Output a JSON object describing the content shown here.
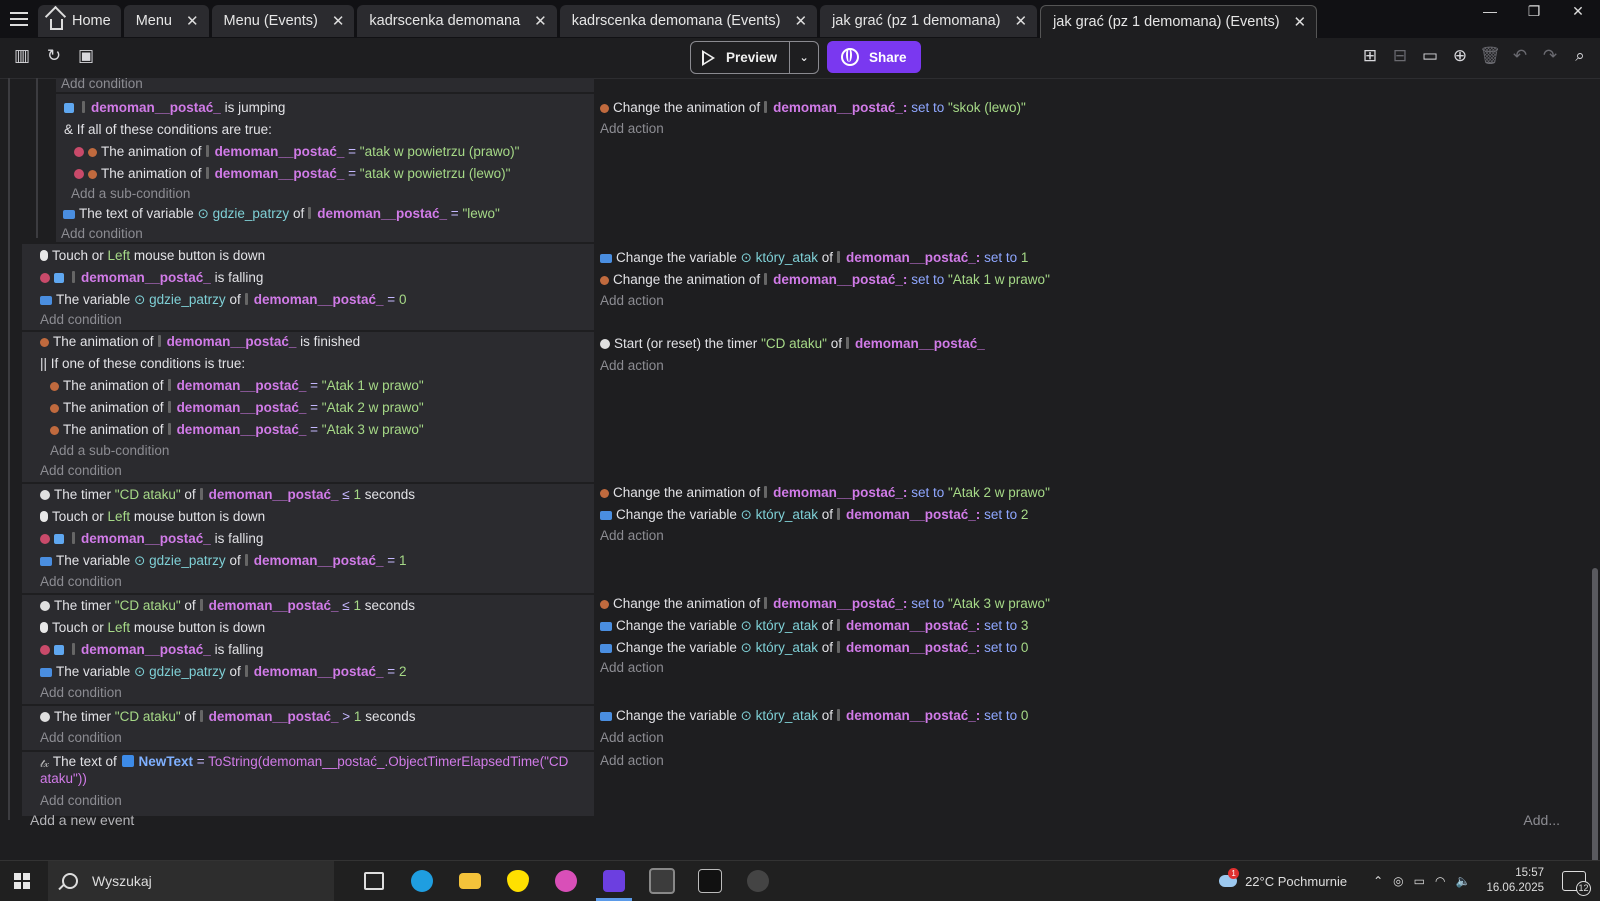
{
  "tabs": [
    {
      "label": "Home",
      "home": true,
      "closable": false
    },
    {
      "label": "Menu",
      "closable": true
    },
    {
      "label": "Menu (Events)",
      "closable": true
    },
    {
      "label": "kadrscenka demomana",
      "closable": true
    },
    {
      "label": "kadrscenka demomana (Events)",
      "closable": true
    },
    {
      "label": "jak grać (pz 1 demomana)",
      "closable": true
    },
    {
      "label": "jak grać (pz 1 demomana) (Events)",
      "closable": true,
      "active": true
    }
  ],
  "window": {
    "minimize": "—",
    "maximize": "❐",
    "close": "✕"
  },
  "toolbar": {
    "preview_label": "Preview",
    "share_label": "Share"
  },
  "common": {
    "add_condition": "Add condition",
    "add_action": "Add action",
    "add_subcondition": "Add a sub-condition",
    "obj": "demoman__postać_",
    "anim_of": "The animation of",
    "change_anim": "Change the animation of",
    "change_var": "Change the variable",
    "set_to": "set to",
    "of": "of",
    "seconds": "seconds",
    "touch_or": "Touch or",
    "left": "Left",
    "mouse_down": "mouse button is down",
    "is_falling": "is falling",
    "the_variable": "The variable",
    "the_timer": "The timer",
    "var_gdzie": "gdzie_patrzy",
    "var_ktory": "który_atak",
    "timer_name": "\"CD ataku\""
  },
  "event1": {
    "is_jumping": "is jumping",
    "if_all": "If all of these conditions are true:",
    "anim_prawo": "\"atak w powietrzu (prawo)\"",
    "anim_lewo": "\"atak w powietrzu (lewo)\"",
    "text_of_var": "The text of variable",
    "lewo": "\"lewo\"",
    "action_anim": "\"skok (lewo)\""
  },
  "event2": {
    "var_value": "0",
    "action_var_value": "1",
    "action_anim": "\"Atak 1 w prawo\""
  },
  "event3": {
    "is_finished": "is finished",
    "if_one": "If one of these conditions is true:",
    "a1": "\"Atak 1 w prawo\"",
    "a2": "\"Atak 2 w prawo\"",
    "a3": "\"Atak 3 w prawo\"",
    "action_start": "Start (or reset) the timer"
  },
  "event4": {
    "op": "≤",
    "timer_val": "1",
    "var_value": "1",
    "action_anim": "\"Atak 2 w prawo\"",
    "action_var_value": "2"
  },
  "event5": {
    "op": "≤",
    "timer_val": "1",
    "var_value": "2",
    "action_anim": "\"Atak 3 w prawo\"",
    "action_var_value_1": "3",
    "action_var_value_2": "0"
  },
  "event6": {
    "op": ">",
    "timer_val": "1",
    "action_var_value": "0"
  },
  "event7": {
    "text_of": "The text of",
    "newtext": "NewText",
    "eq": "=",
    "expr_1": "ToString(demoman__postać_.ObjectTimerElapsedTime(\"CD",
    "expr_2": "ataku\"))"
  },
  "footer": {
    "add_event": "Add a new event",
    "add_more": "Add..."
  },
  "taskbar": {
    "search_placeholder": "Wyszukaj",
    "weather": "22°C  Pochmurnie",
    "weather_badge": "1",
    "time": "15:57",
    "date": "16.06.2025",
    "notif_count": "12"
  },
  "colors": {
    "object": "#d17be8",
    "string": "#a6d987",
    "keyword": "#8fa7ff",
    "share": "#7a38f0"
  }
}
